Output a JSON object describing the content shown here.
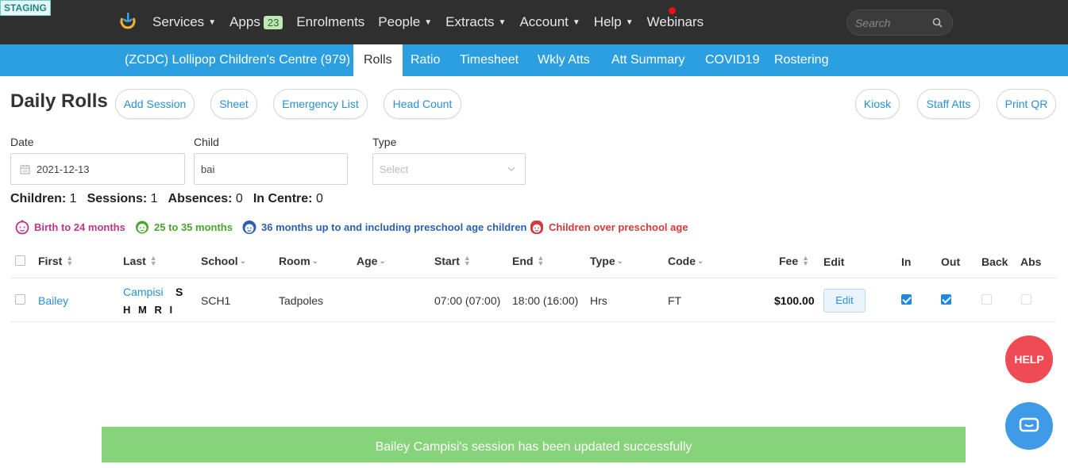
{
  "env_badge": "STAGING",
  "topnav": {
    "items": [
      {
        "label": "Services",
        "caret": true
      },
      {
        "label": "Apps",
        "badge": "23"
      },
      {
        "label": "Enrolments"
      },
      {
        "label": "People",
        "caret": true
      },
      {
        "label": "Extracts",
        "caret": true
      },
      {
        "label": "Account",
        "caret": true
      },
      {
        "label": "Help",
        "caret": true
      },
      {
        "label": "Webinars"
      }
    ],
    "search_placeholder": "Search"
  },
  "subnav": {
    "centre": "(ZCDC) Lollipop Children's Centre (979)",
    "tabs": [
      "Rolls",
      "Ratio",
      "Timesheet",
      "Wkly Atts",
      "Att Summary",
      "COVID19",
      "Rostering"
    ],
    "active": "Rolls"
  },
  "page": {
    "title": "Daily Rolls",
    "actions_left": [
      "Add Session",
      "Sheet",
      "Emergency List",
      "Head Count"
    ],
    "actions_right": [
      "Kiosk",
      "Staff Atts",
      "Print QR"
    ]
  },
  "filters": {
    "date_label": "Date",
    "date_value": "2021-12-13",
    "child_label": "Child",
    "child_value": "bai",
    "type_label": "Type",
    "type_placeholder": "Select"
  },
  "stats": {
    "children_label": "Children:",
    "children": "1",
    "sessions_label": "Sessions:",
    "sessions": "1",
    "absences_label": "Absences:",
    "absences": "0",
    "in_centre_label": "In Centre:",
    "in_centre": "0"
  },
  "legend": [
    {
      "label": "Birth to 24 months",
      "color": "#c0338e"
    },
    {
      "label": "25 to 35 months",
      "color": "#4aa52c"
    },
    {
      "label": "36 months up to and including preschool age children",
      "color": "#2b5fb0"
    },
    {
      "label": "Children over preschool age",
      "color": "#d23a3a"
    }
  ],
  "table": {
    "headers": {
      "first": "First",
      "last": "Last",
      "school": "School",
      "room": "Room",
      "age": "Age",
      "start": "Start",
      "end": "End",
      "type": "Type",
      "code": "Code",
      "fee": "Fee",
      "edit": "Edit",
      "in": "In",
      "out": "Out",
      "back": "Back",
      "abs": "Abs"
    },
    "rows": [
      {
        "first": "Bailey",
        "last": "Campisi",
        "flag_s": "S",
        "flags": "H M R I",
        "school": "SCH1",
        "room": "Tadpoles",
        "age": "",
        "start": "07:00 (07:00)",
        "end": "18:00 (16:00)",
        "type": "Hrs",
        "code": "FT",
        "fee": "$100.00",
        "edit_label": "Edit",
        "in": true,
        "out": true,
        "back": false,
        "abs": false
      }
    ]
  },
  "help_label": "HELP",
  "toast": "Bailey Campisi's session has been updated successfully"
}
